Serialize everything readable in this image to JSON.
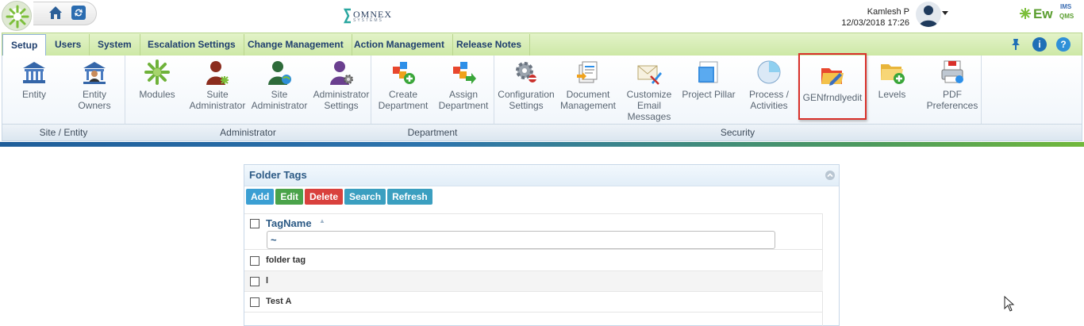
{
  "header": {
    "user_name": "Kamlesh P",
    "datetime": "12/03/2018 17:26",
    "omnex_brand": "OMNEX",
    "omnex_sub": "SYSTEMS",
    "app_logo": {
      "ew": "Ew",
      "ims": "IMS",
      "qms": "QMS"
    },
    "nav_icons": [
      "home-icon",
      "refresh-icon"
    ]
  },
  "tabs": [
    {
      "label": "Setup",
      "active": true
    },
    {
      "label": "Users",
      "active": false
    },
    {
      "label": "System",
      "active": false
    },
    {
      "label": "Escalation Settings",
      "active": false
    },
    {
      "label": "Change Management",
      "active": false
    },
    {
      "label": "Action Management",
      "active": false
    },
    {
      "label": "Release Notes",
      "active": false
    }
  ],
  "tab_tools": [
    {
      "icon": "pin-icon",
      "color": "#1f6fb6"
    },
    {
      "icon": "info-icon",
      "color": "#1f6fb6"
    },
    {
      "icon": "help-icon",
      "color": "#2f90d8"
    }
  ],
  "ribbon": {
    "buttons": [
      {
        "label": "Entity",
        "icon": "building-icon"
      },
      {
        "label": "Entity\nOwners",
        "icon": "building-owner-icon"
      },
      {
        "label": "Modules",
        "icon": "modules-icon"
      },
      {
        "label": "Suite\nAdministrator",
        "icon": "suite-admin-icon"
      },
      {
        "label": "Site\nAdministrator",
        "icon": "site-admin-icon"
      },
      {
        "label": "Administrator\nSettings",
        "icon": "admin-settings-icon"
      },
      {
        "label": "Create\nDepartment",
        "icon": "create-department-icon"
      },
      {
        "label": "Assign\nDepartment",
        "icon": "assign-department-icon"
      },
      {
        "label": "Configuration\nSettings",
        "icon": "configuration-icon"
      },
      {
        "label": "Document\nManagement",
        "icon": "document-icon"
      },
      {
        "label": "Customize\nEmail\nMessages",
        "icon": "email-icon"
      },
      {
        "label": "Project Pillar",
        "icon": "project-pillar-icon"
      },
      {
        "label": "Process /\nActivities",
        "icon": "process-icon"
      },
      {
        "label": "GENfrndlyedit",
        "icon": "folder-edit-icon"
      },
      {
        "label": "Levels",
        "icon": "levels-folder-icon"
      },
      {
        "label": "PDF\nPreferences",
        "icon": "pdf-icon"
      }
    ],
    "groups": [
      {
        "label": "Site / Entity"
      },
      {
        "label": "Administrator"
      },
      {
        "label": "Department"
      },
      {
        "label": "Security"
      }
    ]
  },
  "panel": {
    "title": "Folder Tags",
    "toolbar": [
      {
        "label": "Add",
        "color": "#3b9fd3"
      },
      {
        "label": "Edit",
        "color": "#4aa34a"
      },
      {
        "label": "Delete",
        "color": "#d9413d"
      },
      {
        "label": "Search",
        "color": "#3b9fc0"
      },
      {
        "label": "Refresh",
        "color": "#3b9fc0"
      }
    ],
    "grid": {
      "column": "TagName",
      "filter_value": "~",
      "rows": [
        "folder tag",
        "l",
        "Test A"
      ]
    }
  }
}
